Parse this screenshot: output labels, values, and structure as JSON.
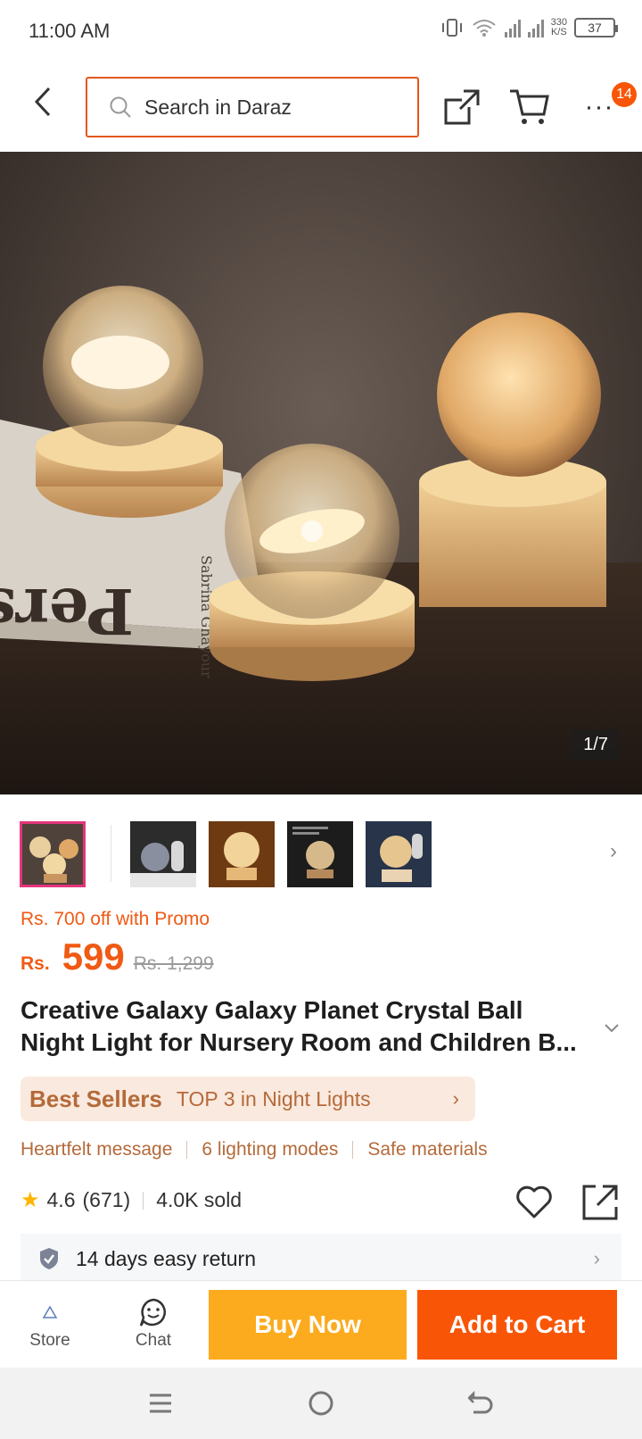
{
  "status_bar": {
    "time": "11:00 AM",
    "net_speed": "330",
    "net_speed_unit": "K/S",
    "battery": "37"
  },
  "header": {
    "search_placeholder": "Search in Daraz",
    "cart_badge": "14"
  },
  "gallery": {
    "counter": "1/7",
    "book_title": "Pers",
    "book_author": "Sabrina Ghayour"
  },
  "price": {
    "promo": "Rs. 700 off with Promo",
    "currency": "Rs.",
    "current": "599",
    "original": "Rs. 1,299"
  },
  "product": {
    "title": "Creative Galaxy Galaxy Planet Crystal Ball Night Light for Nursery Room and Children B..."
  },
  "best_sellers": {
    "label": "Best Sellers",
    "rank": "TOP 3 in Night Lights"
  },
  "features": [
    "Heartfelt message",
    "6 lighting modes",
    "Safe materials"
  ],
  "rating": {
    "score": "4.6",
    "count": "(671)",
    "sold": "4.0K sold"
  },
  "returns": {
    "label": "14 days easy return"
  },
  "bottom_bar": {
    "store": "Store",
    "chat": "Chat",
    "buy_now": "Buy Now",
    "add_to_cart": "Add to Cart"
  },
  "colors": {
    "accent": "#f85606",
    "buy_now": "#fcab1e",
    "promo_text": "#f05a14",
    "best_seller_bg": "#fae9de"
  }
}
